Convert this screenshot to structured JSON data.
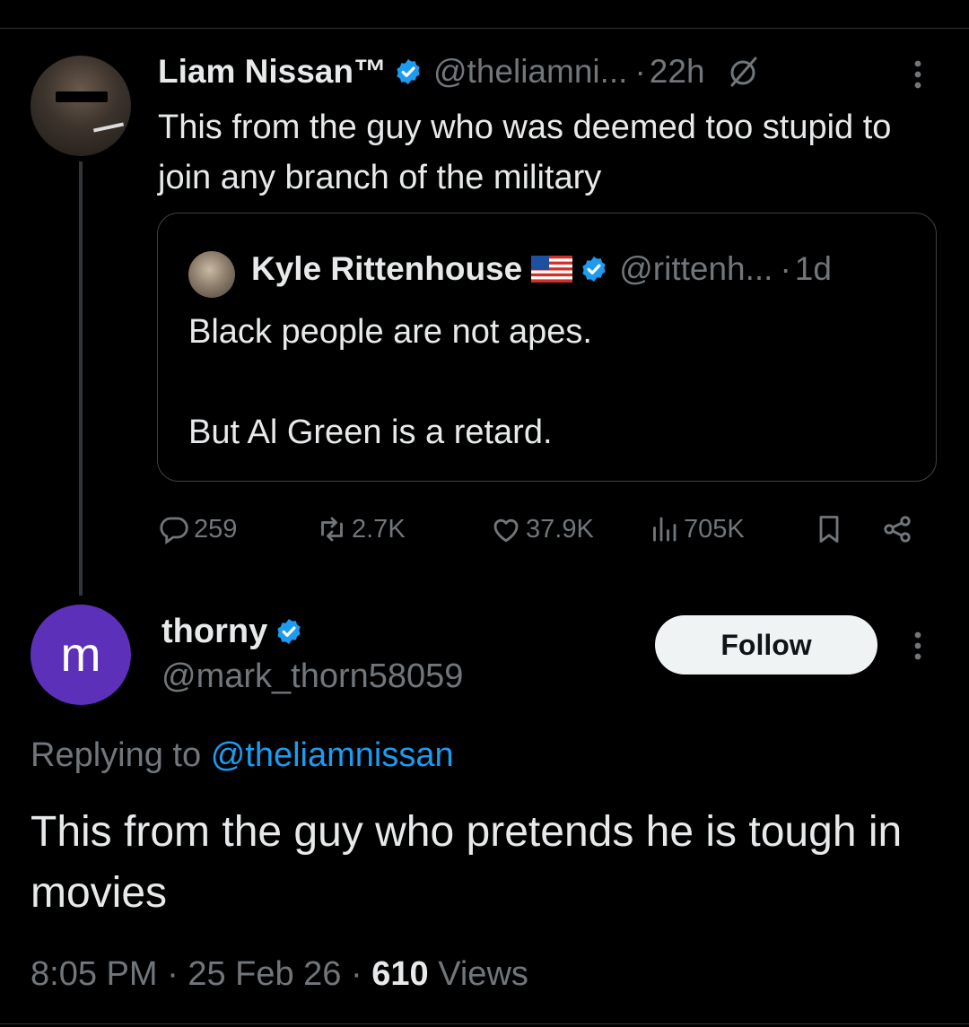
{
  "parent_tweet": {
    "author_name": "Liam Nissan™",
    "handle": "@theliamni...",
    "separator": "·",
    "time": "22h",
    "text": "This from the guy who was deemed too stupid to join any branch of the military",
    "quoted_tweet": {
      "author_name": "Kyle Rittenhouse",
      "handle": "@rittenh...",
      "separator": "·",
      "time": "1d",
      "line1": "Black people are not apes.",
      "line2": "But Al Green is a retard."
    },
    "actions": {
      "replies": "259",
      "reposts": "2.7K",
      "likes": "37.9K",
      "views": "705K"
    }
  },
  "reply": {
    "avatar_letter": "m",
    "author_name": "thorny",
    "handle": "@mark_thorn58059",
    "follow_label": "Follow",
    "replying_prefix": "Replying to",
    "replying_handle": "@theliamnissan",
    "text": "This from the guy who pretends he is tough in movies",
    "time": "8:05 PM",
    "separator": "·",
    "date": "25 Feb 26",
    "views_count": "610",
    "views_label": "Views"
  },
  "colors": {
    "background": "#000000",
    "text": "#e7e9ea",
    "muted": "#71767b",
    "link": "#1d9bf0",
    "verified": "#1d9bf0",
    "avatar_purple": "#5c30b8"
  }
}
